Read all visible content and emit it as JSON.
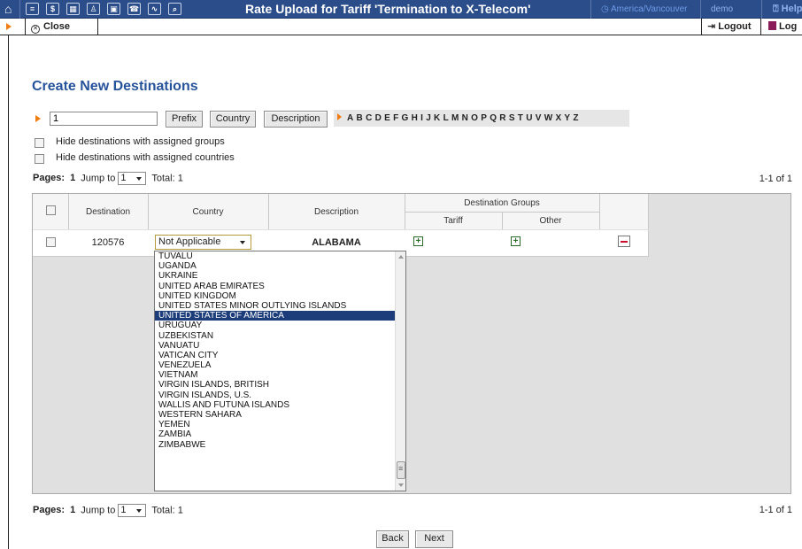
{
  "topbar": {
    "title": "Rate Upload for Tariff 'Termination to X-Telecom'",
    "timezone": "America/Vancouver",
    "user": "demo",
    "help": "Help",
    "icons": [
      "home-icon",
      "list-icon",
      "dollar-icon",
      "grid-icon",
      "person-icon",
      "chip-icon",
      "phone-icon",
      "chart-icon",
      "search-icon"
    ]
  },
  "bar2": {
    "close_label": "Close",
    "logout_label": "Logout",
    "log_label": "Log"
  },
  "heading": "Create New Destinations",
  "filter": {
    "value": "1",
    "buttons": [
      "Prefix",
      "Country",
      "Description"
    ],
    "letters": [
      "A",
      "B",
      "C",
      "D",
      "E",
      "F",
      "G",
      "H",
      "I",
      "J",
      "K",
      "L",
      "M",
      "N",
      "O",
      "P",
      "Q",
      "R",
      "S",
      "T",
      "U",
      "V",
      "W",
      "X",
      "Y",
      "Z"
    ]
  },
  "options": {
    "hide_groups": "Hide destinations with assigned groups",
    "hide_countries": "Hide destinations with assigned countries"
  },
  "pager": {
    "pages_label": "Pages:",
    "page": "1",
    "jump_label": "Jump to",
    "jump_value": "1",
    "total_label": "Total: 1",
    "count": "1-1 of 1"
  },
  "table": {
    "headers": {
      "destination": "Destination",
      "country": "Country",
      "description": "Description",
      "dest_groups": "Destination Groups",
      "tariff": "Tariff",
      "other": "Other"
    },
    "row": {
      "destination": "120576",
      "country": "Not Applicable",
      "description": "ALABAMA"
    }
  },
  "dropdown": {
    "items": [
      "TUVALU",
      "UGANDA",
      "UKRAINE",
      "UNITED ARAB EMIRATES",
      "UNITED KINGDOM",
      "UNITED STATES MINOR OUTLYING ISLANDS",
      "UNITED STATES OF AMERICA",
      "URUGUAY",
      "UZBEKISTAN",
      "VANUATU",
      "VATICAN CITY",
      "VENEZUELA",
      "VIETNAM",
      "VIRGIN ISLANDS, BRITISH",
      "VIRGIN ISLANDS, U.S.",
      "WALLIS AND FUTUNA ISLANDS",
      "WESTERN SAHARA",
      "YEMEN",
      "ZAMBIA",
      "ZIMBABWE"
    ],
    "selected": "UNITED STATES OF AMERICA"
  },
  "footer": {
    "back_label": "Back",
    "next_label": "Next"
  },
  "colors": {
    "topbar": "#2b4d89",
    "heading": "#27539a",
    "accent_arrow": "#f07d10",
    "selected_item": "#1c3d7a"
  }
}
